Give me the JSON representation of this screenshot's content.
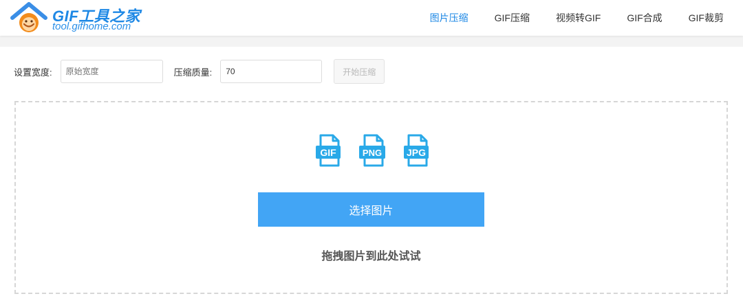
{
  "logo": {
    "title": "GIF工具之家",
    "subtitle": "tool.gifhome.com"
  },
  "nav": {
    "items": [
      {
        "label": "图片压缩",
        "active": true
      },
      {
        "label": "GIF压缩",
        "active": false
      },
      {
        "label": "视频转GIF",
        "active": false
      },
      {
        "label": "GIF合成",
        "active": false
      },
      {
        "label": "GIF裁剪",
        "active": false
      }
    ]
  },
  "controls": {
    "width_label": "设置宽度:",
    "width_placeholder": "原始宽度",
    "width_value": "",
    "quality_label": "压缩质量:",
    "quality_value": "70",
    "start_label": "开始压缩"
  },
  "dropzone": {
    "file_types": [
      "GIF",
      "PNG",
      "JPG"
    ],
    "choose_label": "选择图片",
    "drag_tip": "拖拽图片到此处试试"
  },
  "colors": {
    "accent": "#1e88e5",
    "button": "#42a5f5",
    "icon": "#29a9e8"
  }
}
